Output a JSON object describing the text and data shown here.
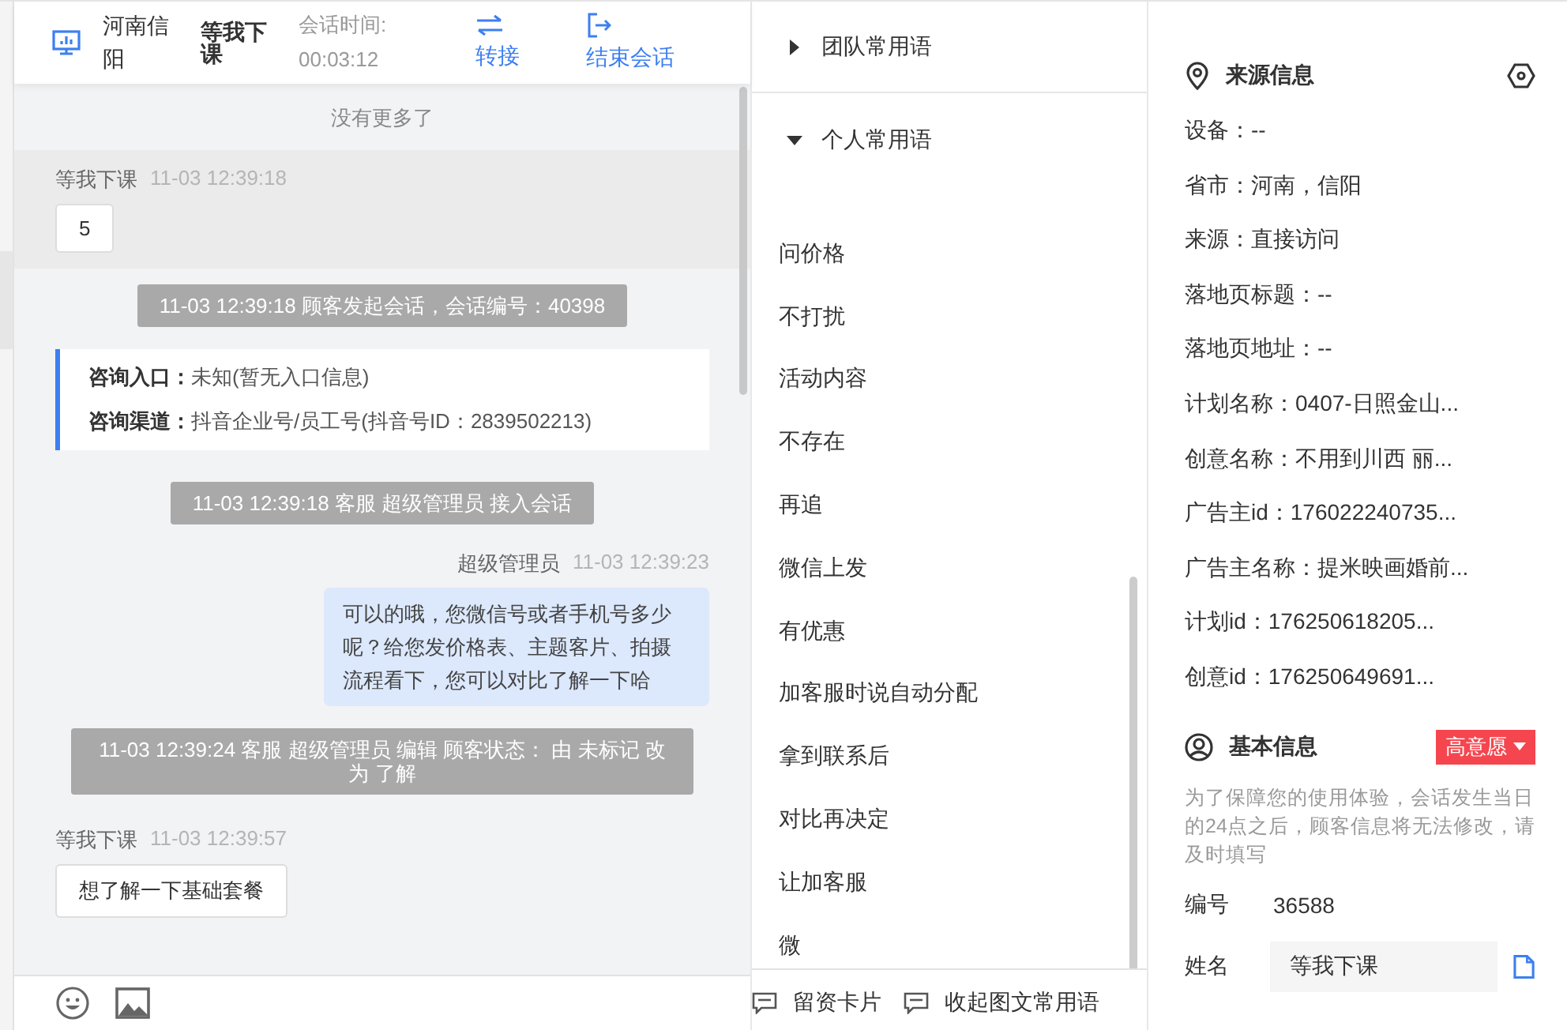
{
  "header": {
    "location": "河南信阳",
    "customer": "等我下课",
    "time_label": "会话时间:",
    "time": "00:03:12",
    "actions": [
      {
        "kind": "transfer",
        "label": "转接"
      },
      {
        "kind": "end",
        "label": "结束会话"
      }
    ]
  },
  "messages": [
    {
      "kind": "notice",
      "text": "没有更多了"
    },
    {
      "kind": "customer",
      "highlighted": true,
      "sender": "等我下课",
      "time": "11-03 12:39:18",
      "text": "5"
    },
    {
      "kind": "system",
      "text": "11-03 12:39:18 顾客发起会话，会话编号：40398"
    },
    {
      "kind": "entry",
      "lines": [
        {
          "label": "咨询入口：",
          "value": "未知(暂无入口信息)"
        },
        {
          "label": "咨询渠道：",
          "value": "抖音企业号/员工号(抖音号ID：2839502213)"
        }
      ]
    },
    {
      "kind": "system",
      "text": "11-03 12:39:18 客服 超级管理员 接入会话"
    },
    {
      "kind": "agent",
      "sender": "超级管理员",
      "time": "11-03 12:39:23",
      "text": "可以的哦，您微信号或者手机号多少呢？给您发价格表、主题客片、拍摄流程看下，您可以对比了解一下哈"
    },
    {
      "kind": "system",
      "text": "11-03 12:39:24 客服 超级管理员 编辑 顾客状态： 由 未标记 改为 了解"
    },
    {
      "kind": "customer",
      "highlighted": false,
      "sender": "等我下课",
      "time": "11-03 12:39:57",
      "text": "想了解一下基础套餐"
    }
  ],
  "phrases": {
    "groups": [
      {
        "label": "团队常用语",
        "expanded": false
      },
      {
        "label": "个人常用语",
        "expanded": true
      }
    ],
    "items": [
      "问价格",
      "不打扰",
      "活动内容",
      "不存在",
      "再追",
      "微信上发",
      "有优惠",
      "加客服时说自动分配",
      "拿到联系后",
      "对比再决定",
      "让加客服",
      "微"
    ],
    "footer": [
      "留资卡片",
      "收起图文常用语"
    ]
  },
  "source": {
    "title": "来源信息",
    "fields": [
      "设备：--",
      "省市：河南，信阳",
      "来源：直接访问",
      "落地页标题：--",
      "落地页地址：--",
      "计划名称：0407-日照金山...",
      "创意名称：不用到川西 丽...",
      "广告主id：176022240735...",
      "广告主名称：提米映画婚前...",
      "计划id：176250618205...",
      "创意id：176250649691..."
    ]
  },
  "basic": {
    "title": "基本信息",
    "tag": "高意愿",
    "notice": "为了保障您的使用体验，会话发生当日的24点之后，顾客信息将无法修改，请及时填写",
    "id_label": "编号",
    "id": "36588",
    "name_label": "姓名",
    "name": "等我下课"
  }
}
